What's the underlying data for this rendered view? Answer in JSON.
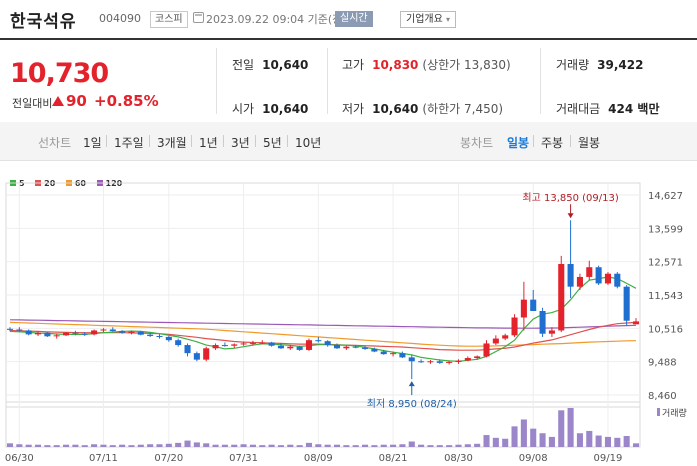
{
  "header": {
    "name": "한국석유",
    "code": "004090",
    "market": "코스피",
    "datetime": "2023.09.22 09:04 기준(장중)",
    "realtime": "실시간",
    "overview": "기업개요",
    "overview_arrow": "▾"
  },
  "price": {
    "current": "10,730",
    "vs_label": "전일대비",
    "change": "90",
    "rate": "+0.85%"
  },
  "stats": {
    "prev_label": "전일",
    "prev": "10,640",
    "open_label": "시가",
    "open": "10,640",
    "high_label": "고가",
    "high": "10,830",
    "upper": "(상한가 13,830)",
    "low_label": "저가",
    "low": "10,640",
    "lower": "(하한가 7,450)",
    "volume_label": "거래량",
    "volume": "39,422",
    "amount_label": "거래대금",
    "amount": "424 백만"
  },
  "periods": {
    "line_label": "선차트",
    "line_items": [
      "1일",
      "1주일",
      "3개월",
      "1년",
      "3년",
      "5년",
      "10년"
    ],
    "candle_label": "봉차트",
    "candle_items": [
      "일봉",
      "주봉",
      "월봉"
    ],
    "active": "일봉"
  },
  "colors": {
    "up": "#e4222b",
    "down": "#1f6fd1",
    "ma5": "#3cb043",
    "ma20": "#e0514f",
    "ma60": "#f09a2a",
    "ma120": "#9b59b6",
    "volume": "#9b86c9"
  },
  "chart_data": {
    "type": "candlestick",
    "legend": [
      "5",
      "20",
      "60",
      "120"
    ],
    "y_ticks": [
      "14,627",
      "13,599",
      "12,571",
      "11,543",
      "10,516",
      "9,488",
      "8,460"
    ],
    "ylim": [
      8460,
      14627
    ],
    "x_tick_labels": [
      "06/30",
      "07/11",
      "07/20",
      "07/31",
      "08/09",
      "08/21",
      "08/30",
      "09/08",
      "09/19"
    ],
    "x_tick_index": [
      1,
      10,
      17,
      25,
      33,
      41,
      48,
      56,
      64
    ],
    "volume_label": "거래량",
    "annotations": {
      "max_label": "최고 13,850 (09/13)",
      "max_index": 60,
      "max_value": 13850,
      "min_label": "최저 8,950 (08/24)",
      "min_index": 43,
      "min_value": 8950
    },
    "candles": [
      [
        10500,
        10550,
        10420,
        10480
      ],
      [
        10480,
        10550,
        10400,
        10450
      ],
      [
        10450,
        10480,
        10300,
        10330
      ],
      [
        10330,
        10420,
        10280,
        10380
      ],
      [
        10380,
        10400,
        10250,
        10270
      ],
      [
        10270,
        10350,
        10200,
        10300
      ],
      [
        10300,
        10400,
        10280,
        10380
      ],
      [
        10380,
        10440,
        10300,
        10350
      ],
      [
        10350,
        10400,
        10280,
        10330
      ],
      [
        10330,
        10480,
        10300,
        10450
      ],
      [
        10450,
        10520,
        10400,
        10480
      ],
      [
        10480,
        10550,
        10420,
        10430
      ],
      [
        10430,
        10460,
        10350,
        10380
      ],
      [
        10380,
        10450,
        10330,
        10410
      ],
      [
        10410,
        10430,
        10300,
        10320
      ],
      [
        10320,
        10380,
        10250,
        10280
      ],
      [
        10280,
        10330,
        10200,
        10250
      ],
      [
        10250,
        10280,
        10100,
        10150
      ],
      [
        10150,
        10200,
        9950,
        10000
      ],
      [
        10000,
        10050,
        9650,
        9750
      ],
      [
        9750,
        9800,
        9500,
        9550
      ],
      [
        9550,
        9950,
        9500,
        9900
      ],
      [
        9900,
        10050,
        9850,
        10000
      ],
      [
        10000,
        10080,
        9950,
        9980
      ],
      [
        9980,
        10050,
        9900,
        10020
      ],
      [
        10020,
        10100,
        9980,
        10050
      ],
      [
        10050,
        10130,
        10000,
        10060
      ],
      [
        10060,
        10150,
        10020,
        10080
      ],
      [
        10080,
        10100,
        9950,
        9980
      ],
      [
        9980,
        10050,
        9880,
        9900
      ],
      [
        9900,
        10000,
        9850,
        9950
      ],
      [
        9950,
        9980,
        9820,
        9850
      ],
      [
        9850,
        10200,
        9820,
        10150
      ],
      [
        10150,
        10250,
        10080,
        10120
      ],
      [
        10120,
        10150,
        9950,
        10000
      ],
      [
        10000,
        10050,
        9880,
        9900
      ],
      [
        9900,
        9980,
        9850,
        9950
      ],
      [
        9950,
        10000,
        9900,
        9920
      ],
      [
        9920,
        9980,
        9850,
        9880
      ],
      [
        9880,
        9920,
        9780,
        9800
      ],
      [
        9800,
        9850,
        9700,
        9720
      ],
      [
        9720,
        9800,
        9650,
        9750
      ],
      [
        9750,
        9800,
        9600,
        9620
      ],
      [
        9620,
        9700,
        8950,
        9500
      ],
      [
        9500,
        9560,
        9450,
        9480
      ],
      [
        9480,
        9540,
        9420,
        9500
      ],
      [
        9500,
        9560,
        9420,
        9450
      ],
      [
        9450,
        9520,
        9400,
        9480
      ],
      [
        9480,
        9560,
        9420,
        9520
      ],
      [
        9520,
        9650,
        9500,
        9600
      ],
      [
        9600,
        9680,
        9550,
        9650
      ],
      [
        9650,
        10150,
        9620,
        10050
      ],
      [
        10050,
        10300,
        10000,
        10200
      ],
      [
        10200,
        10350,
        10150,
        10300
      ],
      [
        10300,
        10950,
        10250,
        10850
      ],
      [
        10850,
        11950,
        10450,
        11400
      ],
      [
        11400,
        11700,
        11050,
        11050
      ],
      [
        11050,
        11150,
        10250,
        10350
      ],
      [
        10350,
        10550,
        10250,
        10450
      ],
      [
        10450,
        12750,
        10400,
        12500
      ],
      [
        12500,
        13850,
        11450,
        11800
      ],
      [
        11800,
        12200,
        11700,
        12100
      ],
      [
        12100,
        12600,
        12000,
        12400
      ],
      [
        12400,
        12450,
        11850,
        11900
      ],
      [
        11900,
        12250,
        11850,
        12200
      ],
      [
        12200,
        12250,
        11750,
        11800
      ],
      [
        11800,
        11850,
        10600,
        10750
      ],
      [
        10640,
        10830,
        10640,
        10730
      ]
    ],
    "volume": [
      8,
      6,
      5,
      5,
      4,
      4,
      5,
      5,
      4,
      6,
      5,
      4,
      5,
      4,
      5,
      6,
      6,
      7,
      9,
      14,
      10,
      8,
      5,
      5,
      5,
      6,
      5,
      4,
      5,
      4,
      5,
      4,
      9,
      6,
      5,
      5,
      4,
      4,
      5,
      4,
      5,
      5,
      6,
      12,
      5,
      4,
      4,
      4,
      5,
      6,
      7,
      26,
      20,
      18,
      45,
      60,
      40,
      30,
      22,
      80,
      85,
      30,
      35,
      25,
      22,
      20,
      24,
      8
    ],
    "ma5": [
      10420,
      10410,
      10390,
      10370,
      10360,
      10340,
      10330,
      10330,
      10330,
      10350,
      10380,
      10400,
      10420,
      10430,
      10420,
      10390,
      10350,
      10300,
      10250,
      10180,
      10100,
      10000,
      9950,
      9880,
      9900,
      9950,
      10000,
      10040,
      10030,
      10010,
      9990,
      9960,
      9980,
      10010,
      10010,
      10000,
      10000,
      9970,
      9930,
      9880,
      9830,
      9780,
      9740,
      9700,
      9620,
      9580,
      9540,
      9510,
      9500,
      9530,
      9560,
      9650,
      9800,
      9950,
      10150,
      10500,
      10800,
      10950,
      11000,
      11100,
      11400,
      11750,
      12000,
      12050,
      12100,
      12050,
      11900,
      11750
    ],
    "ma20": [
      10450,
      10440,
      10430,
      10420,
      10410,
      10400,
      10390,
      10385,
      10380,
      10380,
      10380,
      10380,
      10380,
      10375,
      10370,
      10360,
      10350,
      10330,
      10300,
      10270,
      10240,
      10200,
      10170,
      10140,
      10110,
      10090,
      10080,
      10070,
      10060,
      10050,
      10040,
      10030,
      10030,
      10030,
      10020,
      10010,
      10000,
      9990,
      9980,
      9970,
      9960,
      9950,
      9940,
      9920,
      9900,
      9880,
      9860,
      9850,
      9840,
      9840,
      9840,
      9860,
      9880,
      9900,
      9940,
      10000,
      10060,
      10110,
      10160,
      10240,
      10320,
      10400,
      10480,
      10550,
      10610,
      10660,
      10680,
      10700
    ],
    "ma60": [
      10700,
      10690,
      10680,
      10670,
      10660,
      10650,
      10640,
      10630,
      10620,
      10610,
      10600,
      10590,
      10580,
      10570,
      10560,
      10550,
      10540,
      10530,
      10520,
      10510,
      10500,
      10490,
      10470,
      10450,
      10430,
      10410,
      10390,
      10370,
      10350,
      10330,
      10310,
      10290,
      10270,
      10250,
      10230,
      10210,
      10190,
      10170,
      10150,
      10130,
      10110,
      10090,
      10070,
      10050,
      10030,
      10010,
      9995,
      9980,
      9970,
      9965,
      9965,
      9970,
      9975,
      9985,
      9995,
      10005,
      10015,
      10025,
      10035,
      10045,
      10060,
      10075,
      10090,
      10100,
      10110,
      10120,
      10130,
      10135
    ],
    "ma120": [
      10780,
      10775,
      10770,
      10765,
      10760,
      10755,
      10750,
      10745,
      10740,
      10735,
      10730,
      10725,
      10720,
      10715,
      10710,
      10705,
      10700,
      10695,
      10690,
      10685,
      10680,
      10675,
      10670,
      10665,
      10660,
      10655,
      10650,
      10645,
      10640,
      10635,
      10630,
      10625,
      10620,
      10615,
      10610,
      10605,
      10600,
      10595,
      10590,
      10585,
      10580,
      10575,
      10570,
      10565,
      10560,
      10555,
      10550,
      10545,
      10540,
      10535,
      10530,
      10528,
      10526,
      10524,
      10522,
      10520,
      10520,
      10522,
      10525,
      10530,
      10540,
      10550,
      10560,
      10570,
      10580,
      10590,
      10600,
      10610
    ]
  }
}
